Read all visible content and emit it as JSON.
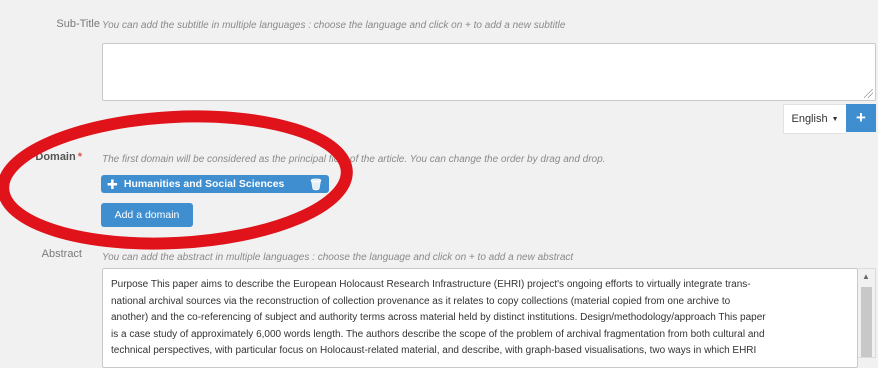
{
  "subtitle": {
    "label": "Sub-Title",
    "help": "You can add the subtitle in multiple languages : choose the language and click on + to add a new subtitle",
    "language": "English",
    "add_symbol": "+"
  },
  "domain": {
    "label": "Domain",
    "required": "*",
    "help": "The first domain will be considered as the principal field of the article. You can change the order by drag and drop.",
    "tags": [
      "Humanities and Social Sciences"
    ],
    "add_button": "Add a domain"
  },
  "abstract": {
    "label": "Abstract",
    "help": "You can add the abstract in multiple languages : choose the language and click on + to add a new abstract",
    "lines": [
      "Purpose This paper aims to describe the European Holocaust Research Infrastructure (EHRI) project's ongoing efforts to virtually integrate trans-",
      "national archival sources via the reconstruction of collection provenance as it relates to copy collections (material copied from one archive to",
      "another) and the co-referencing of subject and authority terms across material held by distinct institutions. Design/methodology/approach This paper",
      "is a case study of approximately 6,000 words length. The authors describe the scope of the problem of archival fragmentation from both cultural and",
      "technical perspectives, with particular focus on Holocaust-related material, and describe, with graph-based visualisations, two ways in which EHRI"
    ]
  },
  "colors": {
    "accent": "#3e8ed0",
    "annotation": "#e0131a",
    "background": "#f1f1f1"
  }
}
